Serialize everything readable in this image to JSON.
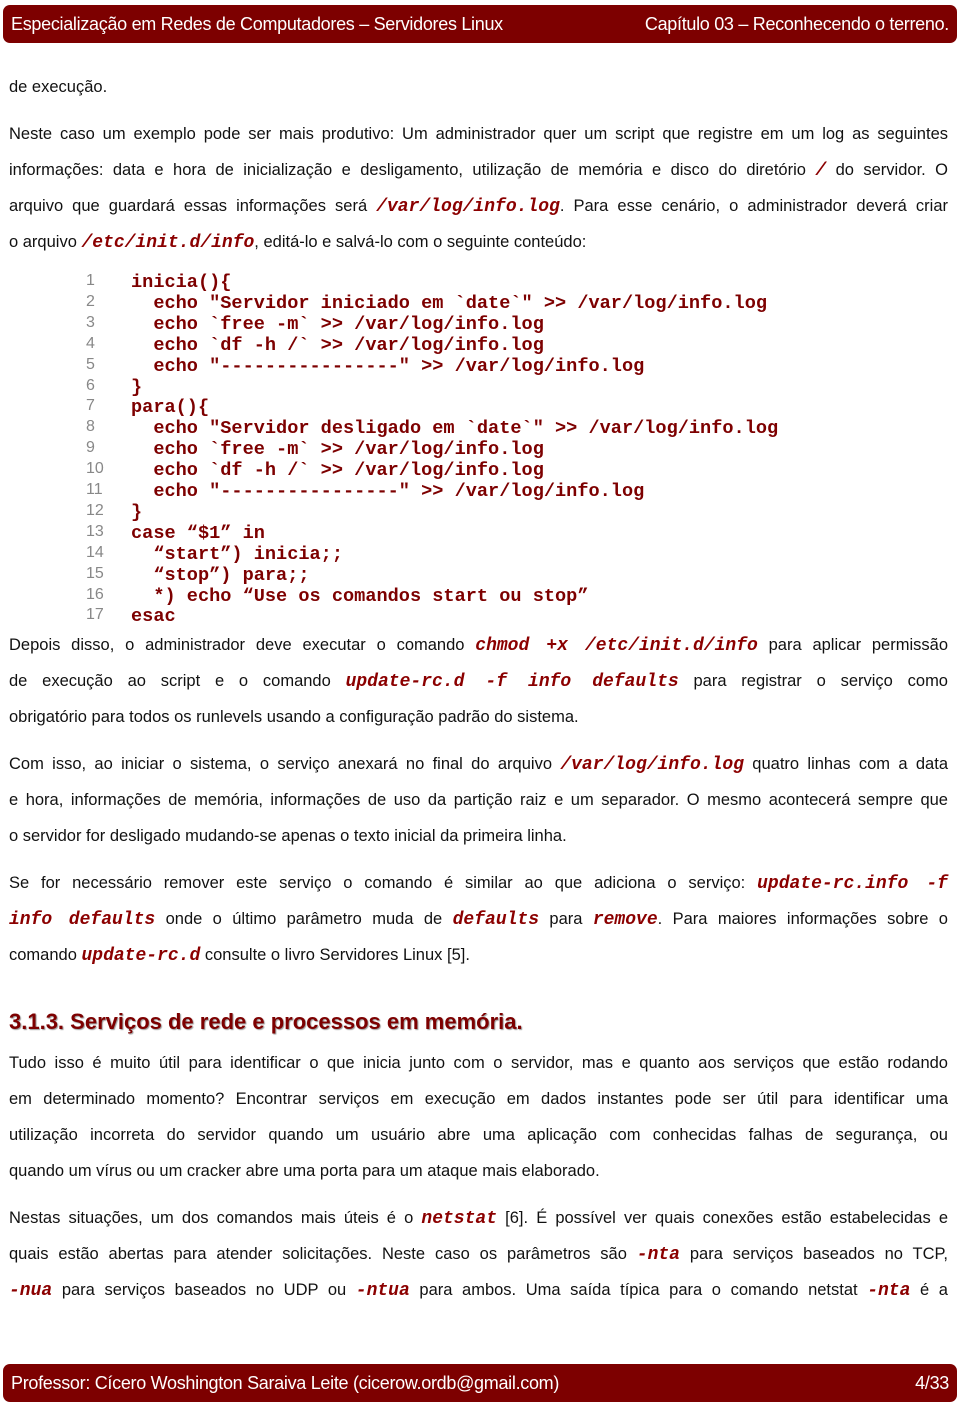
{
  "header": {
    "left": "Especialização em Redes de Computadores – Servidores Linux",
    "right": "Capítulo 03 – Reconhecendo o terreno."
  },
  "footer": {
    "left": "Professor: Cícero Woshington Saraiva Leite (cicerow.ordb@gmail.com)",
    "right": "4/33"
  },
  "colors": {
    "brand": "#7d0000",
    "code": "#7d0000"
  },
  "blocks_top": [
    {
      "lines": [
        [
          {
            "t": "de execução."
          }
        ]
      ]
    },
    {
      "lines": [
        [
          {
            "t": "Neste caso um exemplo pode ser mais produtivo: Um administrador quer um script que registre em um log as seguintes"
          }
        ],
        [
          {
            "t": "informações: data e hora de inicialização e desligamento, utilização de memória e disco do diretório "
          },
          {
            "t": "/",
            "c": 1
          },
          {
            "t": " do servidor. O"
          }
        ],
        [
          {
            "t": "arquivo que guardará essas informações será "
          },
          {
            "t": "/var/log/info.log",
            "c": 1
          },
          {
            "t": ". Para esse cenário, o administrador deverá criar"
          }
        ],
        [
          {
            "t": "o arquivo "
          },
          {
            "t": "/etc/init.d/info",
            "c": 1
          },
          {
            "t": ", editá-lo e salvá-lo com o seguinte conteúdo:"
          }
        ]
      ]
    }
  ],
  "code": [
    {
      "n": "1",
      "t": "inicia(){"
    },
    {
      "n": "2",
      "t": "  echo \"Servidor iniciado em `date`\" >> /var/log/info.log"
    },
    {
      "n": "3",
      "t": "  echo `free -m` >> /var/log/info.log"
    },
    {
      "n": "4",
      "t": "  echo `df -h /` >> /var/log/info.log"
    },
    {
      "n": "5",
      "t": "  echo \"----------------\" >> /var/log/info.log"
    },
    {
      "n": "6",
      "t": "}"
    },
    {
      "n": "7",
      "t": "para(){"
    },
    {
      "n": "8",
      "t": "  echo \"Servidor desligado em `date`\" >> /var/log/info.log"
    },
    {
      "n": "9",
      "t": "  echo `free -m` >> /var/log/info.log"
    },
    {
      "n": "10",
      "t": "  echo `df -h /` >> /var/log/info.log"
    },
    {
      "n": "11",
      "t": "  echo \"----------------\" >> /var/log/info.log"
    },
    {
      "n": "12",
      "t": "}"
    },
    {
      "n": "13",
      "t": "case “$1” in"
    },
    {
      "n": "14",
      "t": "  “start”) inicia;;"
    },
    {
      "n": "15",
      "t": "  “stop”) para;;"
    },
    {
      "n": "16",
      "t": "  *) echo “Use os comandos start ou stop”"
    },
    {
      "n": "17",
      "t": "esac"
    }
  ],
  "blocks_bottom": [
    {
      "lines": [
        [
          {
            "t": "Depois disso, o administrador deve executar o comando "
          },
          {
            "t": "chmod +x /etc/init.d/info",
            "c": 1
          },
          {
            "t": " para aplicar permissão"
          }
        ],
        [
          {
            "t": "de execução ao script e o comando "
          },
          {
            "t": "update-rc.d  -f  info  defaults",
            "c": 1
          },
          {
            "t": " para registrar o serviço como"
          }
        ],
        [
          {
            "t": "obrigatório para todos os runlevels usando a configuração padrão do sistema."
          }
        ]
      ]
    },
    {
      "lines": [
        [
          {
            "t": "Com isso, ao iniciar o sistema, o serviço anexará no final do arquivo "
          },
          {
            "t": "/var/log/info.log",
            "c": 1
          },
          {
            "t": " quatro linhas com a data"
          }
        ],
        [
          {
            "t": "e hora, informações de memória, informações de uso da partição raiz e um separador. O mesmo acontecerá sempre que"
          }
        ],
        [
          {
            "t": "o servidor for desligado mudando-se apenas o texto inicial da primeira linha."
          }
        ]
      ]
    },
    {
      "lines": [
        [
          {
            "t": "Se for necessário remover este serviço o comando é similar ao que adiciona o serviço: "
          },
          {
            "t": "update-rc.info -f",
            "c": 1
          }
        ],
        [
          {
            "t": "info defaults",
            "c": 1
          },
          {
            "t": " onde o último parâmetro muda de "
          },
          {
            "t": "defaults",
            "c": 1
          },
          {
            "t": " para "
          },
          {
            "t": "remove",
            "c": 1
          },
          {
            "t": ". Para maiores informações sobre o"
          }
        ],
        [
          {
            "t": "comando "
          },
          {
            "t": "update-rc.d",
            "c": 1
          },
          {
            "t": " consulte o livro Servidores Linux [5]."
          }
        ]
      ]
    },
    {
      "heading": "3.1.3. Serviços de rede e processos em memória."
    },
    {
      "lines": [
        [
          {
            "t": "Tudo isso é muito útil para identificar o que inicia junto com o servidor, mas e quanto aos serviços que estão rodando"
          }
        ],
        [
          {
            "t": "em determinado momento? Encontrar serviços em execução em dados instantes pode ser útil para identificar uma"
          }
        ],
        [
          {
            "t": "utilização incorreta do servidor quando um usuário abre uma aplicação com conhecidas falhas de segurança, ou"
          }
        ],
        [
          {
            "t": "quando um vírus ou um cracker abre uma porta para um ataque mais elaborado."
          }
        ]
      ]
    },
    {
      "lines": [
        [
          {
            "t": "Nestas situações, um dos comandos mais úteis é o "
          },
          {
            "t": "netstat",
            "c": 1
          },
          {
            "t": " [6].  É possível ver quais conexões estão estabelecidas e"
          }
        ],
        [
          {
            "t": "quais estão abertas para atender solicitações. Neste caso os parâmetros são "
          },
          {
            "t": "-nta",
            "c": 1
          },
          {
            "t": " para serviços baseados no TCP,"
          }
        ],
        [
          {
            "t": "-nua",
            "c": 1
          },
          {
            "t": " para serviços baseados no UDP ou "
          },
          {
            "t": "-ntua",
            "c": 1
          },
          {
            "t": " para ambos. Uma saída típica para o comando netstat "
          },
          {
            "t": "-nta",
            "c": 1
          },
          {
            "t": " é a"
          }
        ]
      ],
      "continues": true
    }
  ]
}
